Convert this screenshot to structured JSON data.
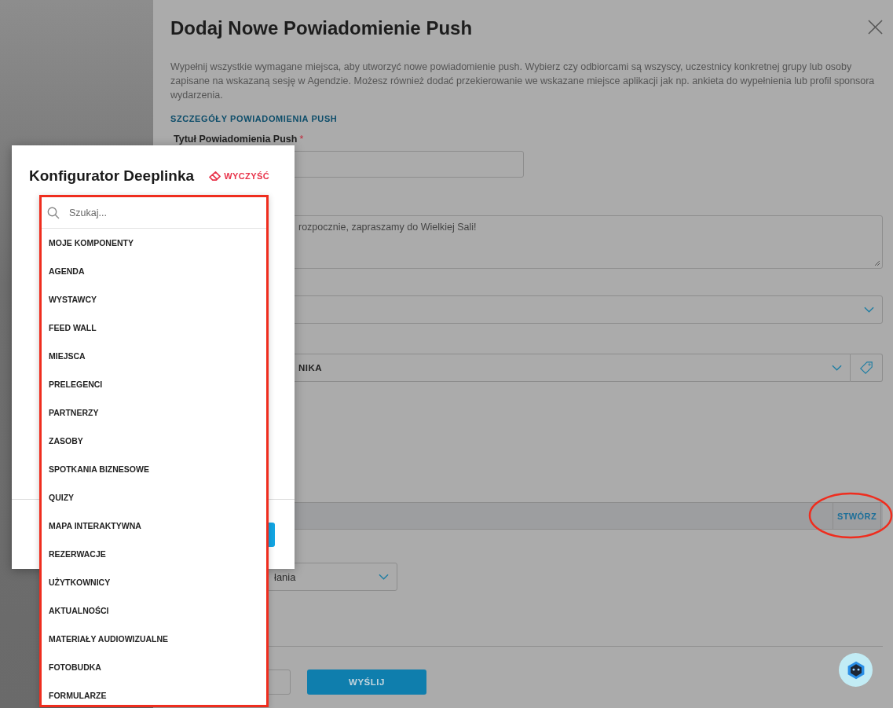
{
  "drawer": {
    "title": "Dodaj Nowe Powiadomienie Push",
    "description": "Wypełnij wszystkie wymagane miejsca, aby utworzyć nowe powiadomienie push. Wybierz czy odbiorcami są wszyscy, uczestnicy konkretnej grupy lub osoby zapisane na wskazaną sesję w Agendzie. Możesz również dodać przekierowanie we wskazane miejsce aplikacji jak np. ankieta do wypełnienia lub profil sponsora wydarzenia.",
    "section_heading": "SZCZEGÓŁY POWIADOMIENIA PUSH",
    "title_field": {
      "label": "Tytuł Powiadomienia Push",
      "required_mark": "*"
    },
    "message_field": {
      "value": "rozpocznie, zapraszamy do Wielkiej Sali!"
    },
    "recipient_select": {
      "value": "NIKA"
    },
    "deeplink_field": {
      "button": "STWÓRZ"
    },
    "action_select": {
      "value": "łania"
    },
    "send_button": "WYŚLIJ"
  },
  "modal": {
    "title": "Konfigurator Deeplinka",
    "clear_button": "WYCZYŚĆ",
    "search": {
      "placeholder": "Szukaj..."
    },
    "items": [
      "MOJE KOMPONENTY",
      "AGENDA",
      "WYSTAWCY",
      "FEED WALL",
      "MIEJSCA",
      "PRELEGENCI",
      "PARTNERZY",
      "ZASOBY",
      "SPOTKANIA BIZNESOWE",
      "QUIZY",
      "MAPA INTERAKTYWNA",
      "REZERWACJE",
      "UŻYTKOWNICY",
      "AKTUALNOŚCI",
      "MATERIAŁY AUDIOWIZUALNE",
      "FOTOBUDKA",
      "FORMULARZE"
    ]
  }
}
